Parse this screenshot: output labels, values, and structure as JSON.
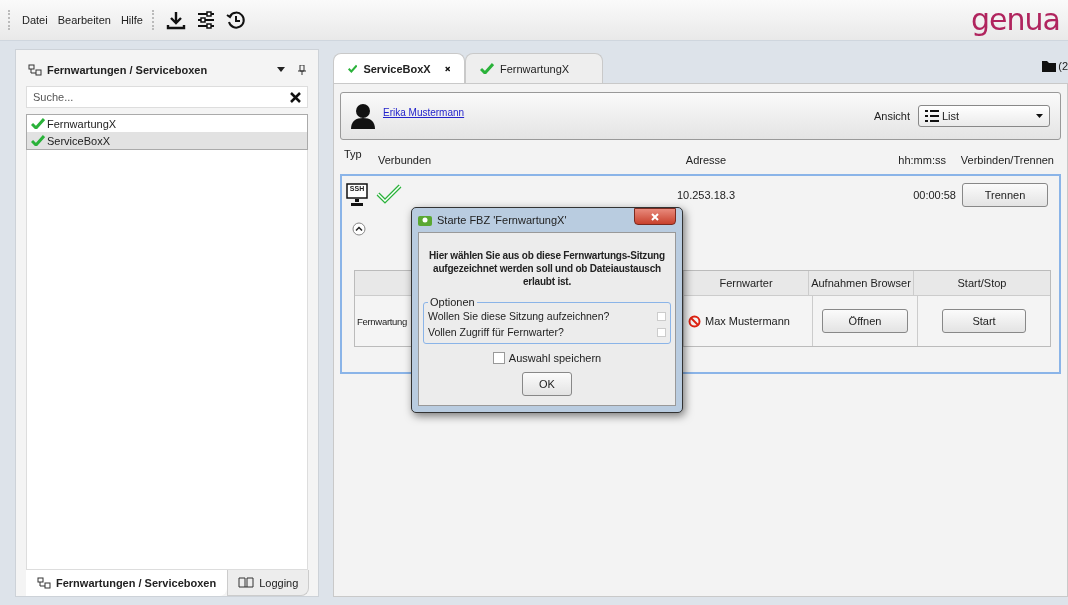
{
  "menu": [
    {
      "label": "Datei"
    },
    {
      "label": "Bearbeiten"
    },
    {
      "label": "Hilfe"
    }
  ],
  "logo": "genua",
  "folder_count": "(2",
  "left_panel": {
    "title": "Fernwartungen / Serviceboxen",
    "search": {
      "placeholder": "Suche..."
    },
    "items": [
      {
        "label": "FernwartungX",
        "selected": false,
        "connected": true
      },
      {
        "label": "ServiceBoxX",
        "selected": true,
        "connected": true
      }
    ],
    "bottom_tabs": [
      {
        "label": "Fernwartungen / Serviceboxen",
        "selected": true,
        "kind": "tree"
      },
      {
        "label": "Logging",
        "selected": false,
        "kind": "book"
      }
    ]
  },
  "tabs": [
    {
      "label": "ServiceBoxX",
      "selected": true,
      "closable": true,
      "connected": true
    },
    {
      "label": "FernwartungX",
      "selected": false,
      "closable": false,
      "connected": true
    }
  ],
  "user": {
    "name": "Erika Mustermann"
  },
  "view": {
    "label": "Ansicht",
    "value": "List"
  },
  "table": {
    "columns": [
      "Typ",
      "Verbunden",
      "Adresse",
      "hh:mm:ss",
      "Verbinden/Trennen"
    ],
    "rows": [
      {
        "type": "SSH",
        "connected": true,
        "address": "10.253.18.3",
        "time": "00:00:58",
        "action": "Trennen",
        "expanded": true
      }
    ]
  },
  "sessions": {
    "columns": [
      "Fernwarter",
      "Aufnahmen Browser",
      "Start/Stop"
    ],
    "rows": [
      {
        "name": "Fernwartung",
        "operator": "Max Mustermann",
        "operator_blocked": true,
        "open": "Öffnen",
        "start": "Start"
      }
    ]
  },
  "dialog": {
    "title": "Starte FBZ 'FernwartungX'",
    "message": "Hier wählen Sie aus ob diese Fernwartungs-Sitzung aufgezeichnet werden soll und ob Dateiaustausch erlaubt ist.",
    "group": "Optionen",
    "options": [
      {
        "label": "Wollen Sie diese Sitzung aufzeichnen?",
        "checked": false
      },
      {
        "label": "Vollen Zugriff für Fernwarter?",
        "checked": false
      }
    ],
    "save": {
      "label": "Auswahl speichern",
      "checked": false
    },
    "button": "OK"
  }
}
